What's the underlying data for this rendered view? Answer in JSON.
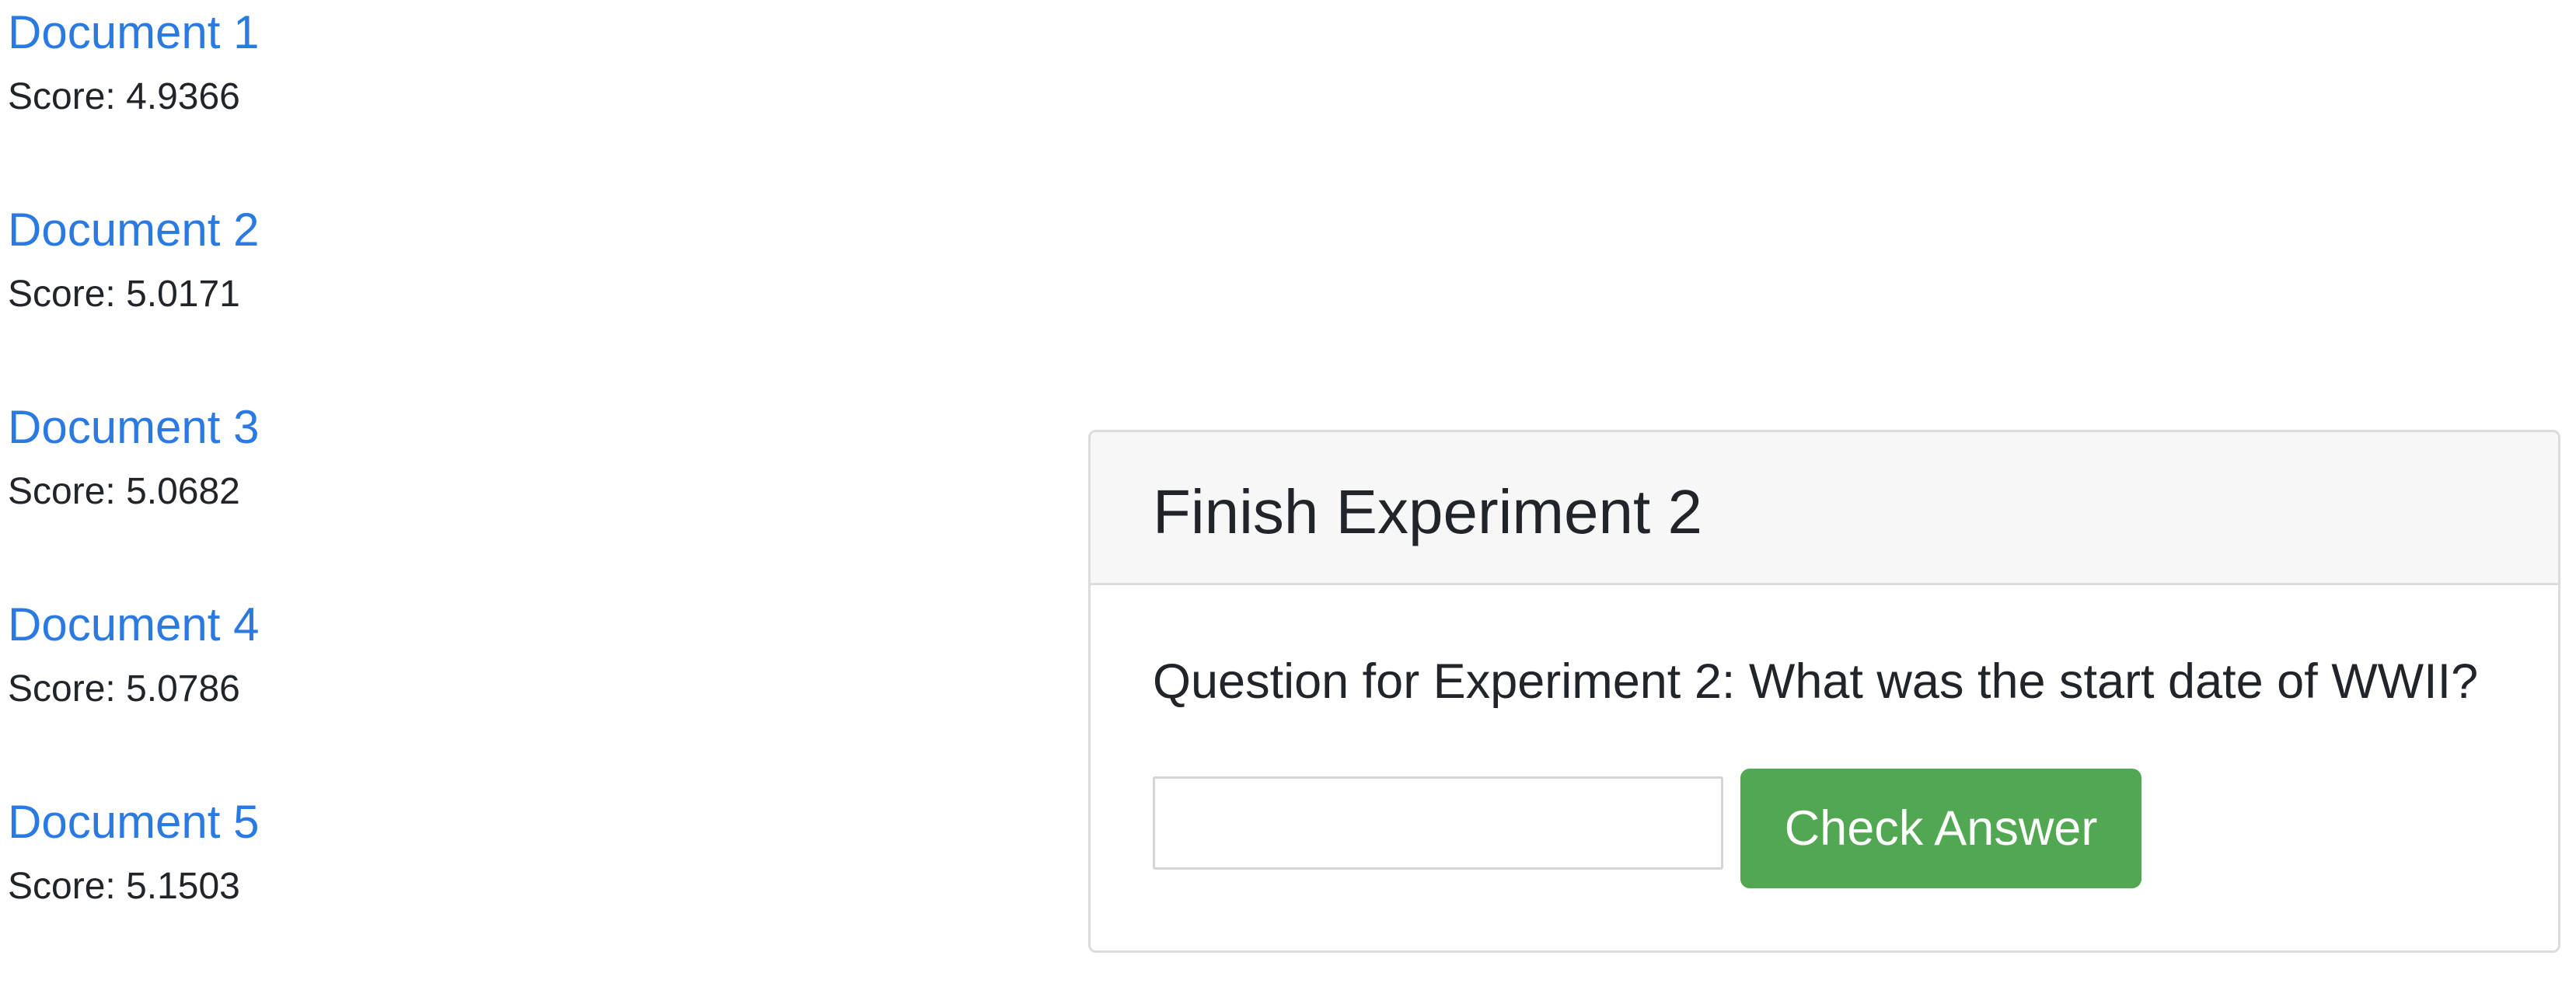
{
  "documents": [
    {
      "title": "Document 1",
      "score": "Score: 4.9366"
    },
    {
      "title": "Document 2",
      "score": "Score: 5.0171"
    },
    {
      "title": "Document 3",
      "score": "Score: 5.0682"
    },
    {
      "title": "Document 4",
      "score": "Score: 5.0786"
    },
    {
      "title": "Document 5",
      "score": "Score: 5.1503"
    }
  ],
  "experiment_card": {
    "title": "Finish Experiment 2",
    "question": "Question for Experiment 2: What was the start date of WWII?",
    "answer_value": "",
    "check_button_label": "Check Answer"
  },
  "colors": {
    "link": "#2a7ae2",
    "button": "#52a752",
    "header_bg": "#f7f7f7"
  }
}
